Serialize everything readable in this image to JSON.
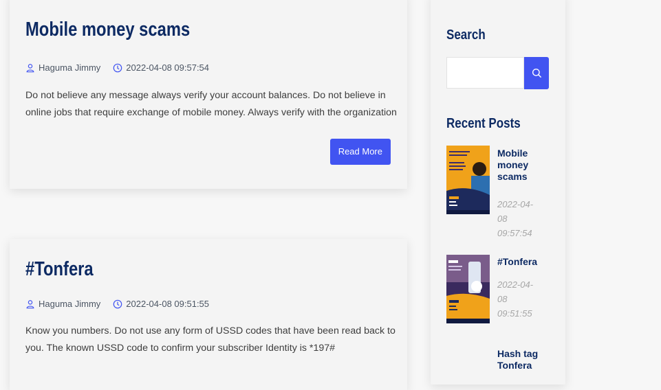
{
  "posts": [
    {
      "title": "Mobile money scams",
      "author": "Haguma Jimmy",
      "datetime": "2022-04-08 09:57:54",
      "excerpt": "Do not believe any message always verify your account balances. Do not believe in online jobs that require exchange of mobile money. Always verify with the organization",
      "read_more_label": "Read More"
    },
    {
      "title": "#Tonfera",
      "author": "Haguma Jimmy",
      "datetime": "2022-04-08 09:51:55",
      "excerpt": "Know you numbers. Do not use any form of USSD codes that have been read back to you. The known USSD code to confirm your subscriber Identity is *197#"
    }
  ],
  "sidebar": {
    "search_heading": "Search",
    "search_value": "",
    "search_icon": "search-icon",
    "recent_heading": "Recent Posts",
    "recent_posts": [
      {
        "title": "Mobile money scams",
        "date": "2022-04-08 09:57:54"
      },
      {
        "title": "#Tonfera",
        "date": "2022-04-08 09:51:55"
      },
      {
        "title": "Hash tag Tonfera"
      }
    ]
  },
  "colors": {
    "accent": "#4154f1",
    "heading": "#0d2a63",
    "background": "#f7f7f7"
  },
  "icons": {
    "author": "person-icon",
    "date": "clock-icon"
  }
}
